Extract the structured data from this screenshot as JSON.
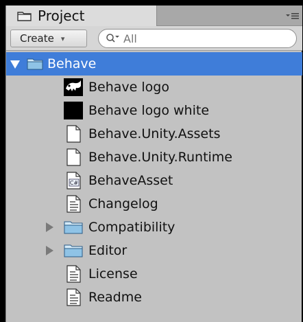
{
  "tab": {
    "label": "Project"
  },
  "toolbar": {
    "create_label": "Create",
    "search_placeholder": "All"
  },
  "tree": {
    "root": {
      "label": "Behave",
      "expanded": true,
      "selected": true
    },
    "items": [
      {
        "label": "Behave logo",
        "icon": "logo-image-icon"
      },
      {
        "label": "Behave logo white",
        "icon": "black-image-icon"
      },
      {
        "label": "Behave.Unity.Assets",
        "icon": "file-icon"
      },
      {
        "label": "Behave.Unity.Runtime",
        "icon": "file-icon"
      },
      {
        "label": "BehaveAsset",
        "icon": "csharp-script-icon"
      },
      {
        "label": "Changelog",
        "icon": "text-file-icon"
      },
      {
        "label": "Compatibility",
        "icon": "folder-icon",
        "expandable": true
      },
      {
        "label": "Editor",
        "icon": "folder-icon",
        "expandable": true
      },
      {
        "label": "License",
        "icon": "text-file-icon"
      },
      {
        "label": "Readme",
        "icon": "text-file-icon"
      }
    ]
  },
  "colors": {
    "selection": "#3f7dd9",
    "panel": "#c2c2c2"
  }
}
